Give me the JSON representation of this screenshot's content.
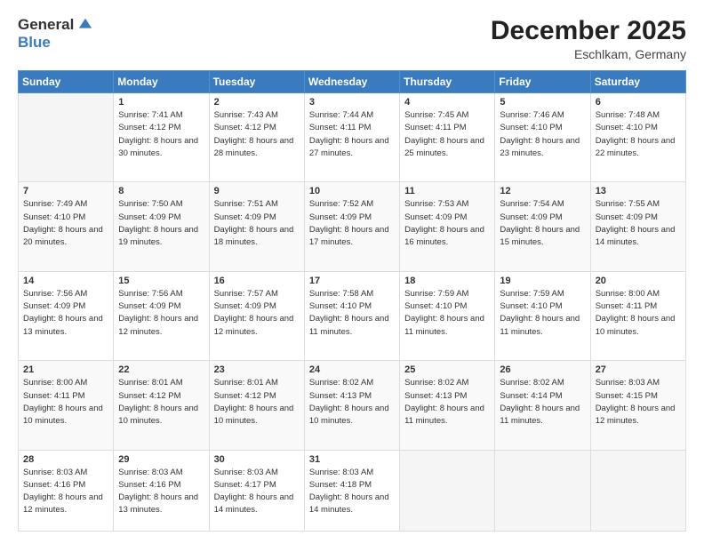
{
  "logo": {
    "general": "General",
    "blue": "Blue"
  },
  "header": {
    "title": "December 2025",
    "location": "Eschlkam, Germany"
  },
  "weekdays": [
    "Sunday",
    "Monday",
    "Tuesday",
    "Wednesday",
    "Thursday",
    "Friday",
    "Saturday"
  ],
  "weeks": [
    [
      {
        "day": "",
        "sunrise": "",
        "sunset": "",
        "daylight": ""
      },
      {
        "day": "1",
        "sunrise": "Sunrise: 7:41 AM",
        "sunset": "Sunset: 4:12 PM",
        "daylight": "Daylight: 8 hours and 30 minutes."
      },
      {
        "day": "2",
        "sunrise": "Sunrise: 7:43 AM",
        "sunset": "Sunset: 4:12 PM",
        "daylight": "Daylight: 8 hours and 28 minutes."
      },
      {
        "day": "3",
        "sunrise": "Sunrise: 7:44 AM",
        "sunset": "Sunset: 4:11 PM",
        "daylight": "Daylight: 8 hours and 27 minutes."
      },
      {
        "day": "4",
        "sunrise": "Sunrise: 7:45 AM",
        "sunset": "Sunset: 4:11 PM",
        "daylight": "Daylight: 8 hours and 25 minutes."
      },
      {
        "day": "5",
        "sunrise": "Sunrise: 7:46 AM",
        "sunset": "Sunset: 4:10 PM",
        "daylight": "Daylight: 8 hours and 23 minutes."
      },
      {
        "day": "6",
        "sunrise": "Sunrise: 7:48 AM",
        "sunset": "Sunset: 4:10 PM",
        "daylight": "Daylight: 8 hours and 22 minutes."
      }
    ],
    [
      {
        "day": "7",
        "sunrise": "Sunrise: 7:49 AM",
        "sunset": "Sunset: 4:10 PM",
        "daylight": "Daylight: 8 hours and 20 minutes."
      },
      {
        "day": "8",
        "sunrise": "Sunrise: 7:50 AM",
        "sunset": "Sunset: 4:09 PM",
        "daylight": "Daylight: 8 hours and 19 minutes."
      },
      {
        "day": "9",
        "sunrise": "Sunrise: 7:51 AM",
        "sunset": "Sunset: 4:09 PM",
        "daylight": "Daylight: 8 hours and 18 minutes."
      },
      {
        "day": "10",
        "sunrise": "Sunrise: 7:52 AM",
        "sunset": "Sunset: 4:09 PM",
        "daylight": "Daylight: 8 hours and 17 minutes."
      },
      {
        "day": "11",
        "sunrise": "Sunrise: 7:53 AM",
        "sunset": "Sunset: 4:09 PM",
        "daylight": "Daylight: 8 hours and 16 minutes."
      },
      {
        "day": "12",
        "sunrise": "Sunrise: 7:54 AM",
        "sunset": "Sunset: 4:09 PM",
        "daylight": "Daylight: 8 hours and 15 minutes."
      },
      {
        "day": "13",
        "sunrise": "Sunrise: 7:55 AM",
        "sunset": "Sunset: 4:09 PM",
        "daylight": "Daylight: 8 hours and 14 minutes."
      }
    ],
    [
      {
        "day": "14",
        "sunrise": "Sunrise: 7:56 AM",
        "sunset": "Sunset: 4:09 PM",
        "daylight": "Daylight: 8 hours and 13 minutes."
      },
      {
        "day": "15",
        "sunrise": "Sunrise: 7:56 AM",
        "sunset": "Sunset: 4:09 PM",
        "daylight": "Daylight: 8 hours and 12 minutes."
      },
      {
        "day": "16",
        "sunrise": "Sunrise: 7:57 AM",
        "sunset": "Sunset: 4:09 PM",
        "daylight": "Daylight: 8 hours and 12 minutes."
      },
      {
        "day": "17",
        "sunrise": "Sunrise: 7:58 AM",
        "sunset": "Sunset: 4:10 PM",
        "daylight": "Daylight: 8 hours and 11 minutes."
      },
      {
        "day": "18",
        "sunrise": "Sunrise: 7:59 AM",
        "sunset": "Sunset: 4:10 PM",
        "daylight": "Daylight: 8 hours and 11 minutes."
      },
      {
        "day": "19",
        "sunrise": "Sunrise: 7:59 AM",
        "sunset": "Sunset: 4:10 PM",
        "daylight": "Daylight: 8 hours and 11 minutes."
      },
      {
        "day": "20",
        "sunrise": "Sunrise: 8:00 AM",
        "sunset": "Sunset: 4:11 PM",
        "daylight": "Daylight: 8 hours and 10 minutes."
      }
    ],
    [
      {
        "day": "21",
        "sunrise": "Sunrise: 8:00 AM",
        "sunset": "Sunset: 4:11 PM",
        "daylight": "Daylight: 8 hours and 10 minutes."
      },
      {
        "day": "22",
        "sunrise": "Sunrise: 8:01 AM",
        "sunset": "Sunset: 4:12 PM",
        "daylight": "Daylight: 8 hours and 10 minutes."
      },
      {
        "day": "23",
        "sunrise": "Sunrise: 8:01 AM",
        "sunset": "Sunset: 4:12 PM",
        "daylight": "Daylight: 8 hours and 10 minutes."
      },
      {
        "day": "24",
        "sunrise": "Sunrise: 8:02 AM",
        "sunset": "Sunset: 4:13 PM",
        "daylight": "Daylight: 8 hours and 10 minutes."
      },
      {
        "day": "25",
        "sunrise": "Sunrise: 8:02 AM",
        "sunset": "Sunset: 4:13 PM",
        "daylight": "Daylight: 8 hours and 11 minutes."
      },
      {
        "day": "26",
        "sunrise": "Sunrise: 8:02 AM",
        "sunset": "Sunset: 4:14 PM",
        "daylight": "Daylight: 8 hours and 11 minutes."
      },
      {
        "day": "27",
        "sunrise": "Sunrise: 8:03 AM",
        "sunset": "Sunset: 4:15 PM",
        "daylight": "Daylight: 8 hours and 12 minutes."
      }
    ],
    [
      {
        "day": "28",
        "sunrise": "Sunrise: 8:03 AM",
        "sunset": "Sunset: 4:16 PM",
        "daylight": "Daylight: 8 hours and 12 minutes."
      },
      {
        "day": "29",
        "sunrise": "Sunrise: 8:03 AM",
        "sunset": "Sunset: 4:16 PM",
        "daylight": "Daylight: 8 hours and 13 minutes."
      },
      {
        "day": "30",
        "sunrise": "Sunrise: 8:03 AM",
        "sunset": "Sunset: 4:17 PM",
        "daylight": "Daylight: 8 hours and 14 minutes."
      },
      {
        "day": "31",
        "sunrise": "Sunrise: 8:03 AM",
        "sunset": "Sunset: 4:18 PM",
        "daylight": "Daylight: 8 hours and 14 minutes."
      },
      {
        "day": "",
        "sunrise": "",
        "sunset": "",
        "daylight": ""
      },
      {
        "day": "",
        "sunrise": "",
        "sunset": "",
        "daylight": ""
      },
      {
        "day": "",
        "sunrise": "",
        "sunset": "",
        "daylight": ""
      }
    ]
  ]
}
